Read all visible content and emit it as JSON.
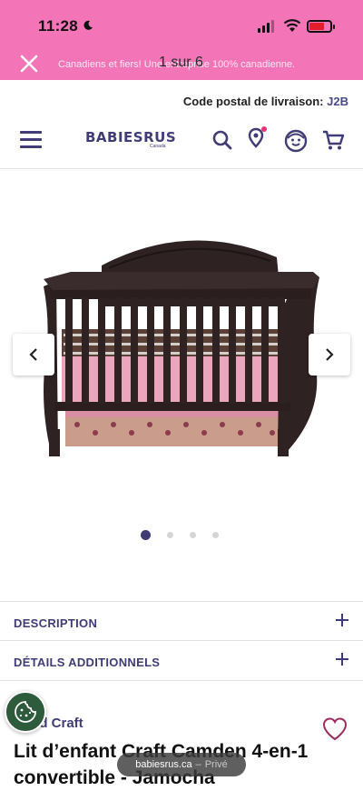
{
  "status_bar": {
    "time": "11:28"
  },
  "promo_banner": {
    "text": "Canadiens et fiers! Une entreprise 100% canadienne.",
    "counter": "1 sur 6"
  },
  "delivery": {
    "label": "Code postal de livraison:",
    "code": "J2B"
  },
  "header": {
    "logo_text": "BABIESRUS",
    "logo_sub": "Canada",
    "icons": [
      "menu-icon",
      "search-icon",
      "location-pin-icon",
      "account-face-icon",
      "cart-icon"
    ]
  },
  "gallery": {
    "image": "convertible crib, Jamocha finish, pink bedding",
    "current_slide": 1,
    "total_dots": 4
  },
  "accordions": [
    {
      "label": "DESCRIPTION"
    },
    {
      "label": "DÉTAILS ADDITIONNELS"
    }
  ],
  "product": {
    "brand": "Child Craft",
    "title": "Lit d’enfant Craft Camden 4-en-1 convertible - Jamocha"
  },
  "browser": {
    "url": "babiesrus.ca",
    "separator": "–",
    "mode": "Privé"
  },
  "colors": {
    "banner_pink": "#f375b7",
    "brand_purple": "#403d76",
    "cookie_green": "#2e5b3c"
  }
}
